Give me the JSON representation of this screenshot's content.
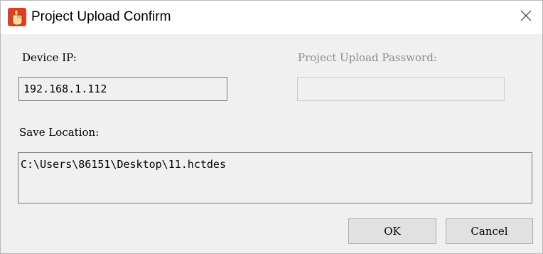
{
  "window": {
    "title": "Project Upload Confirm",
    "app_icon": "hand-pointer-icon"
  },
  "labels": {
    "device_ip": "Device IP:",
    "password": "Project Upload Password:",
    "save_location": "Save Location:"
  },
  "fields": {
    "device_ip_value": "192.168.1.112",
    "password_value": "",
    "save_location_value": "C:\\Users\\86151\\Desktop\\11.hctdes"
  },
  "buttons": {
    "ok": "OK",
    "cancel": "Cancel"
  },
  "icons": {
    "close": "close-icon"
  },
  "colors": {
    "app_icon_bg": "#e04020",
    "window_bg": "#f0f0f0",
    "disabled_text": "#8c8c8c"
  }
}
